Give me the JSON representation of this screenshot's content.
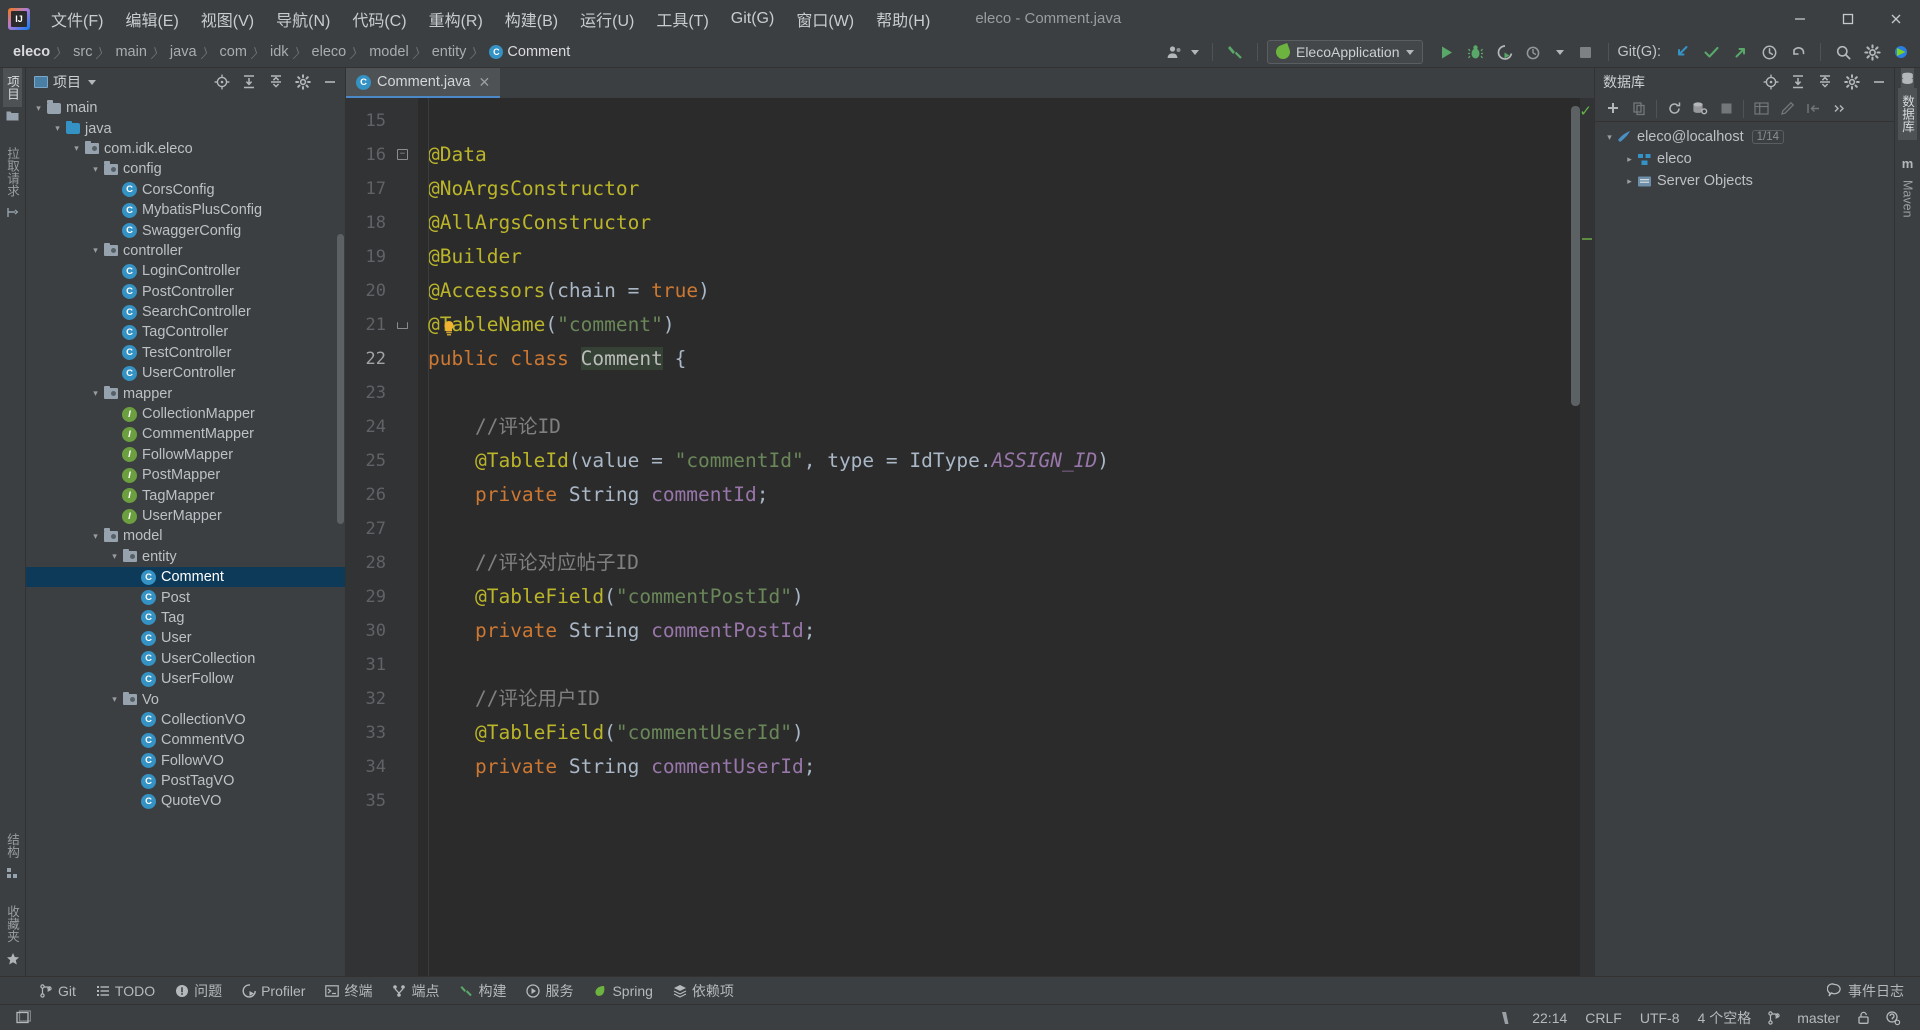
{
  "window": {
    "title": "eleco - Comment.java",
    "minimize_label": "—",
    "maximize_label": "❐",
    "close_label": "✕"
  },
  "menu": {
    "items": [
      {
        "label": "文件(F)",
        "name": "menu-file"
      },
      {
        "label": "编辑(E)",
        "name": "menu-edit"
      },
      {
        "label": "视图(V)",
        "name": "menu-view"
      },
      {
        "label": "导航(N)",
        "name": "menu-navigate"
      },
      {
        "label": "代码(C)",
        "name": "menu-code"
      },
      {
        "label": "重构(R)",
        "name": "menu-refactor"
      },
      {
        "label": "构建(B)",
        "name": "menu-build"
      },
      {
        "label": "运行(U)",
        "name": "menu-run"
      },
      {
        "label": "工具(T)",
        "name": "menu-tools"
      },
      {
        "label": "Git(G)",
        "name": "menu-git"
      },
      {
        "label": "窗口(W)",
        "name": "menu-window"
      },
      {
        "label": "帮助(H)",
        "name": "menu-help"
      }
    ]
  },
  "breadcrumb": {
    "items": [
      "eleco",
      "src",
      "main",
      "java",
      "com",
      "idk",
      "eleco",
      "model",
      "entity"
    ],
    "last": "Comment",
    "last_icon": "C",
    "separator": "〉"
  },
  "toolbar": {
    "run_config": "ElecoApplication",
    "git_label": "Git(G):",
    "run_icon": "▶",
    "debug_icon": "debug-icon",
    "coverage_icon": "coverage-icon",
    "profile_icon": "profile-icon",
    "stop_icon": "■",
    "update_project_icon": "↙",
    "commit_icon": "✓",
    "push_icon": "↗",
    "history_icon": "◷",
    "rollback_icon": "↶",
    "search_icon": "⌕",
    "settings_icon": "⚙"
  },
  "project_panel": {
    "title": "项目",
    "actions": [
      "locate-icon",
      "expand-all-icon",
      "collapse-all-icon",
      "gear-icon",
      "hide-icon"
    ],
    "tree": [
      {
        "label": "main",
        "depth": 1,
        "type": "folder-gray",
        "arrow": "⌄",
        "selected": false
      },
      {
        "label": "java",
        "depth": 2,
        "type": "folder-blue",
        "arrow": "⌄",
        "selected": false
      },
      {
        "label": "com.idk.eleco",
        "depth": 3,
        "type": "package",
        "arrow": "⌄",
        "selected": false
      },
      {
        "label": "config",
        "depth": 4,
        "type": "package",
        "arrow": "⌄",
        "selected": false
      },
      {
        "label": "CorsConfig",
        "depth": 5,
        "type": "class",
        "arrow": "",
        "selected": false
      },
      {
        "label": "MybatisPlusConfig",
        "depth": 5,
        "type": "class",
        "arrow": "",
        "selected": false
      },
      {
        "label": "SwaggerConfig",
        "depth": 5,
        "type": "class",
        "arrow": "",
        "selected": false
      },
      {
        "label": "controller",
        "depth": 4,
        "type": "package",
        "arrow": "⌄",
        "selected": false
      },
      {
        "label": "LoginController",
        "depth": 5,
        "type": "class",
        "arrow": "",
        "selected": false
      },
      {
        "label": "PostController",
        "depth": 5,
        "type": "class",
        "arrow": "",
        "selected": false
      },
      {
        "label": "SearchController",
        "depth": 5,
        "type": "class",
        "arrow": "",
        "selected": false
      },
      {
        "label": "TagController",
        "depth": 5,
        "type": "class",
        "arrow": "",
        "selected": false
      },
      {
        "label": "TestController",
        "depth": 5,
        "type": "class",
        "arrow": "",
        "selected": false
      },
      {
        "label": "UserController",
        "depth": 5,
        "type": "class",
        "arrow": "",
        "selected": false
      },
      {
        "label": "mapper",
        "depth": 4,
        "type": "package",
        "arrow": "⌄",
        "selected": false
      },
      {
        "label": "CollectionMapper",
        "depth": 5,
        "type": "interface",
        "arrow": "",
        "selected": false
      },
      {
        "label": "CommentMapper",
        "depth": 5,
        "type": "interface",
        "arrow": "",
        "selected": false
      },
      {
        "label": "FollowMapper",
        "depth": 5,
        "type": "interface",
        "arrow": "",
        "selected": false
      },
      {
        "label": "PostMapper",
        "depth": 5,
        "type": "interface",
        "arrow": "",
        "selected": false
      },
      {
        "label": "TagMapper",
        "depth": 5,
        "type": "interface",
        "arrow": "",
        "selected": false
      },
      {
        "label": "UserMapper",
        "depth": 5,
        "type": "interface",
        "arrow": "",
        "selected": false
      },
      {
        "label": "model",
        "depth": 4,
        "type": "package",
        "arrow": "⌄",
        "selected": false
      },
      {
        "label": "entity",
        "depth": 5,
        "type": "package",
        "arrow": "⌄",
        "selected": false
      },
      {
        "label": "Comment",
        "depth": 6,
        "type": "class",
        "arrow": "",
        "selected": true
      },
      {
        "label": "Post",
        "depth": 6,
        "type": "class",
        "arrow": "",
        "selected": false
      },
      {
        "label": "Tag",
        "depth": 6,
        "type": "class",
        "arrow": "",
        "selected": false
      },
      {
        "label": "User",
        "depth": 6,
        "type": "class",
        "arrow": "",
        "selected": false
      },
      {
        "label": "UserCollection",
        "depth": 6,
        "type": "class",
        "arrow": "",
        "selected": false
      },
      {
        "label": "UserFollow",
        "depth": 6,
        "type": "class",
        "arrow": "",
        "selected": false
      },
      {
        "label": "Vo",
        "depth": 5,
        "type": "package",
        "arrow": "⌄",
        "selected": false
      },
      {
        "label": "CollectionVO",
        "depth": 6,
        "type": "class",
        "arrow": "",
        "selected": false
      },
      {
        "label": "CommentVO",
        "depth": 6,
        "type": "class",
        "arrow": "",
        "selected": false
      },
      {
        "label": "FollowVO",
        "depth": 6,
        "type": "class",
        "arrow": "",
        "selected": false
      },
      {
        "label": "PostTagVO",
        "depth": 6,
        "type": "class",
        "arrow": "",
        "selected": false
      },
      {
        "label": "QuoteVO",
        "depth": 6,
        "type": "class",
        "arrow": "",
        "selected": false
      }
    ]
  },
  "left_strip": {
    "tabs": [
      {
        "label": "项目",
        "icon": "project-icon",
        "active": true,
        "name": "strip-tab-project"
      },
      {
        "label": "拉取请求",
        "icon": "pull-request-icon",
        "active": false,
        "name": "strip-tab-pull-requests"
      }
    ],
    "bottom_tabs": [
      {
        "label": "结构",
        "icon": "structure-icon",
        "name": "strip-tab-structure"
      },
      {
        "label": "收藏夹",
        "icon": "star-icon",
        "name": "strip-tab-bookmarks"
      }
    ]
  },
  "right_strip": {
    "tabs": [
      {
        "label": "数据库",
        "icon": "database-icon",
        "active": true,
        "name": "strip-tab-database"
      },
      {
        "label": "Maven",
        "icon": "maven-icon",
        "active": false,
        "name": "strip-tab-maven"
      }
    ]
  },
  "editor": {
    "tab": {
      "label": "Comment.java",
      "icon": "C",
      "close": "✕"
    },
    "first_line": 15,
    "lines": [
      {
        "n": 15,
        "tokens": []
      },
      {
        "n": 16,
        "fold": "start",
        "tokens": [
          {
            "t": "@Data",
            "c": "annot"
          }
        ]
      },
      {
        "n": 17,
        "tokens": [
          {
            "t": "@NoArgsConstructor",
            "c": "annot"
          }
        ]
      },
      {
        "n": 18,
        "tokens": [
          {
            "t": "@AllArgsConstructor",
            "c": "annot"
          }
        ]
      },
      {
        "n": 19,
        "tokens": [
          {
            "t": "@Builder",
            "c": "annot"
          }
        ]
      },
      {
        "n": 20,
        "tokens": [
          {
            "t": "@Accessors",
            "c": "annot"
          },
          {
            "t": "(",
            "c": "ident"
          },
          {
            "t": "chain ",
            "c": "ident"
          },
          {
            "t": "= ",
            "c": "ident"
          },
          {
            "t": "true",
            "c": "kw"
          },
          {
            "t": ")",
            "c": "ident"
          }
        ]
      },
      {
        "n": 21,
        "fold": "end",
        "bulb": true,
        "tokens": [
          {
            "t": "@TableName",
            "c": "annot"
          },
          {
            "t": "(",
            "c": "ident"
          },
          {
            "t": "\"comment\"",
            "c": "str"
          },
          {
            "t": ")",
            "c": "ident"
          }
        ]
      },
      {
        "n": 22,
        "current": true,
        "tokens": [
          {
            "t": "public ",
            "c": "kw"
          },
          {
            "t": "class ",
            "c": "kw"
          },
          {
            "t": "Comment",
            "c": "cls-hl"
          },
          {
            "t": " {",
            "c": "ident"
          }
        ]
      },
      {
        "n": 23,
        "tokens": []
      },
      {
        "n": 24,
        "tokens": [
          {
            "t": "    //评论ID",
            "c": "cmt"
          }
        ]
      },
      {
        "n": 25,
        "tokens": [
          {
            "t": "    ",
            "c": "ident"
          },
          {
            "t": "@TableId",
            "c": "annot"
          },
          {
            "t": "(",
            "c": "ident"
          },
          {
            "t": "value ",
            "c": "ident"
          },
          {
            "t": "= ",
            "c": "ident"
          },
          {
            "t": "\"commentId\"",
            "c": "str"
          },
          {
            "t": ", type = IdType.",
            "c": "ident"
          },
          {
            "t": "ASSIGN_ID",
            "c": "stat"
          },
          {
            "t": ")",
            "c": "ident"
          }
        ]
      },
      {
        "n": 26,
        "tokens": [
          {
            "t": "    ",
            "c": "ident"
          },
          {
            "t": "private ",
            "c": "kw"
          },
          {
            "t": "String ",
            "c": "ident"
          },
          {
            "t": "commentId",
            "c": "field"
          },
          {
            "t": ";",
            "c": "ident"
          }
        ]
      },
      {
        "n": 27,
        "tokens": []
      },
      {
        "n": 28,
        "tokens": [
          {
            "t": "    //评论对应帖子ID",
            "c": "cmt"
          }
        ]
      },
      {
        "n": 29,
        "tokens": [
          {
            "t": "    ",
            "c": "ident"
          },
          {
            "t": "@TableField",
            "c": "annot"
          },
          {
            "t": "(",
            "c": "ident"
          },
          {
            "t": "\"commentPostId\"",
            "c": "str"
          },
          {
            "t": ")",
            "c": "ident"
          }
        ]
      },
      {
        "n": 30,
        "tokens": [
          {
            "t": "    ",
            "c": "ident"
          },
          {
            "t": "private ",
            "c": "kw"
          },
          {
            "t": "String ",
            "c": "ident"
          },
          {
            "t": "commentPostId",
            "c": "field"
          },
          {
            "t": ";",
            "c": "ident"
          }
        ]
      },
      {
        "n": 31,
        "tokens": []
      },
      {
        "n": 32,
        "tokens": [
          {
            "t": "    //评论用户ID",
            "c": "cmt"
          }
        ]
      },
      {
        "n": 33,
        "tokens": [
          {
            "t": "    ",
            "c": "ident"
          },
          {
            "t": "@TableField",
            "c": "annot"
          },
          {
            "t": "(",
            "c": "ident"
          },
          {
            "t": "\"commentUserId\"",
            "c": "str"
          },
          {
            "t": ")",
            "c": "ident"
          }
        ]
      },
      {
        "n": 34,
        "tokens": [
          {
            "t": "    ",
            "c": "ident"
          },
          {
            "t": "private ",
            "c": "kw"
          },
          {
            "t": "String ",
            "c": "ident"
          },
          {
            "t": "commentUserId",
            "c": "field"
          },
          {
            "t": ";",
            "c": "ident"
          }
        ]
      },
      {
        "n": 35,
        "tokens": []
      }
    ]
  },
  "database_panel": {
    "title": "数据库",
    "head_actions": [
      "locate-icon",
      "expand-all-icon",
      "collapse-all-icon",
      "gear-icon",
      "hide-icon"
    ],
    "toolbar_icons": [
      "add-icon",
      "copy-icon",
      "refresh-icon",
      "query-console-icon",
      "stop-icon",
      "table-icon",
      "modify-icon",
      "jump-icon",
      "more-icon"
    ],
    "tree": [
      {
        "label": "eleco@localhost",
        "depth": 0,
        "arrow": "⌄",
        "icon": "mysql-icon",
        "badge": "1/14"
      },
      {
        "label": "eleco",
        "depth": 1,
        "arrow": "›",
        "icon": "schema-icon",
        "badge": ""
      },
      {
        "label": "Server Objects",
        "depth": 1,
        "arrow": "›",
        "icon": "server-objects-icon",
        "badge": ""
      }
    ]
  },
  "bottom_tabs": [
    {
      "label": "Git",
      "icon": "git-branch-icon",
      "name": "tool-tab-git"
    },
    {
      "label": "TODO",
      "icon": "todo-icon",
      "name": "tool-tab-todo"
    },
    {
      "label": "问题",
      "icon": "problems-icon",
      "name": "tool-tab-problems"
    },
    {
      "label": "Profiler",
      "icon": "profiler-icon",
      "name": "tool-tab-profiler"
    },
    {
      "label": "终端",
      "icon": "terminal-icon",
      "name": "tool-tab-terminal"
    },
    {
      "label": "端点",
      "icon": "endpoints-icon",
      "name": "tool-tab-endpoints"
    },
    {
      "label": "构建",
      "icon": "build-icon",
      "name": "tool-tab-build"
    },
    {
      "label": "服务",
      "icon": "services-icon",
      "name": "tool-tab-services"
    },
    {
      "label": "Spring",
      "icon": "spring-icon",
      "name": "tool-tab-spring"
    },
    {
      "label": "依赖项",
      "icon": "dependencies-icon",
      "name": "tool-tab-dependencies"
    }
  ],
  "event_log": {
    "label": "事件日志",
    "icon": "balloon-icon"
  },
  "status_bar": {
    "left_icon": "layout-icon",
    "items": [
      {
        "label": "22:14",
        "name": "status-position"
      },
      {
        "label": "CRLF",
        "name": "status-line-separator"
      },
      {
        "label": "UTF-8",
        "name": "status-encoding"
      },
      {
        "label": "4 个空格",
        "name": "status-indent"
      },
      {
        "label": "master",
        "name": "status-branch"
      }
    ],
    "branch_icon": "git-branch-icon",
    "inspection_icon": "inspection-icon",
    "lock_icon": "lock-icon",
    "ide_icon": "ide-settings-icon"
  },
  "colors": {
    "accent_blue": "#4a88c7",
    "selection": "#0d3a58",
    "annotation": "#bbb529",
    "keyword": "#cc7832",
    "string": "#6a8759",
    "field": "#9876aa",
    "comment": "#808080",
    "editor_bg": "#2b2b2b",
    "chrome_bg": "#3c3f41"
  }
}
